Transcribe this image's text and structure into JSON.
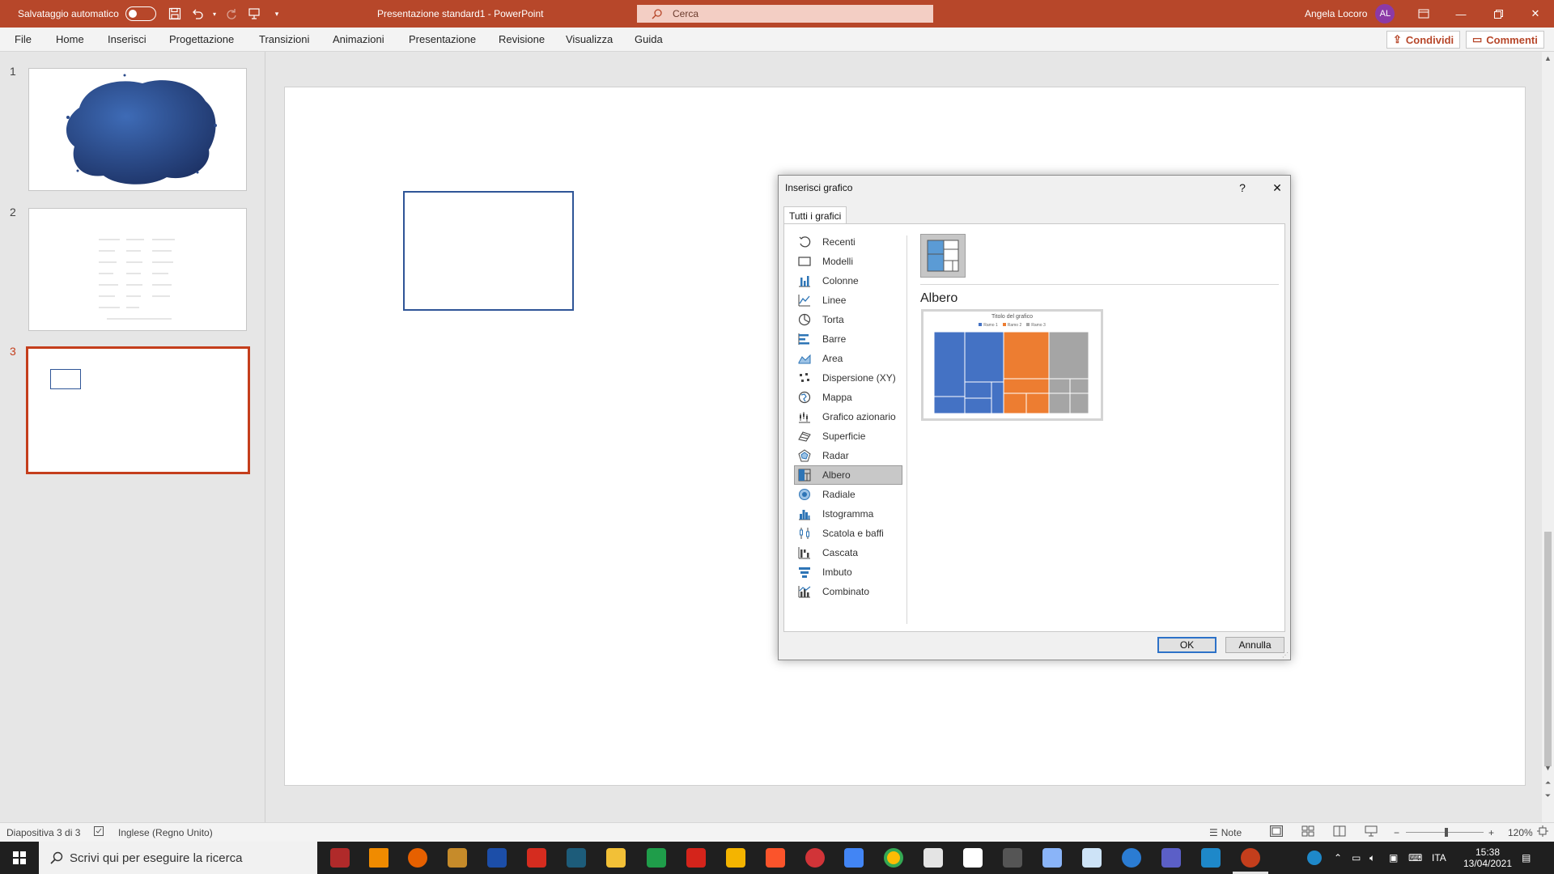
{
  "titlebar": {
    "autosave_label": "Salvataggio automatico",
    "doc_title": "Presentazione standard1  -  PowerPoint",
    "search_placeholder": "Cerca",
    "user_name": "Angela Locoro",
    "user_initials": "AL"
  },
  "menu": {
    "items": [
      "File",
      "Home",
      "Inserisci",
      "Progettazione",
      "Transizioni",
      "Animazioni",
      "Presentazione",
      "Revisione",
      "Visualizza",
      "Guida"
    ],
    "share_label": "Condividi",
    "comments_label": "Commenti"
  },
  "thumbnails": {
    "numbers": [
      "1",
      "2",
      "3"
    ],
    "selected": "3"
  },
  "dialog": {
    "title": "Inserisci grafico",
    "help": "?",
    "close": "✕",
    "tab": "Tutti i grafici",
    "categories": [
      "Recenti",
      "Modelli",
      "Colonne",
      "Linee",
      "Torta",
      "Barre",
      "Area",
      "Dispersione (XY)",
      "Mappa",
      "Grafico azionario",
      "Superficie",
      "Radar",
      "Albero",
      "Radiale",
      "Istogramma",
      "Scatola e baffi",
      "Cascata",
      "Imbuto",
      "Combinato"
    ],
    "selected_category": "Albero",
    "subtype_name": "Albero",
    "ok": "OK",
    "cancel": "Annulla",
    "preview": {
      "title": "Titolo del grafico",
      "legend": [
        "Ramo 1",
        "Ramo 2",
        "Ramo 3"
      ],
      "colors": {
        "ramo1": "#4472c4",
        "ramo2": "#ed7d31",
        "ramo3": "#a5a5a5"
      }
    }
  },
  "statusbar": {
    "slide_info": "Diapositiva 3 di 3",
    "language": "Inglese (Regno Unito)",
    "notes": "Note",
    "zoom": "120%"
  },
  "taskbar": {
    "search_placeholder": "Scrivi qui per eseguire la ricerca",
    "language": "ITA",
    "time": "15:38",
    "date": "13/04/2021"
  },
  "colors": {
    "accent": "#b7472a",
    "selection": "#c43e1c"
  }
}
